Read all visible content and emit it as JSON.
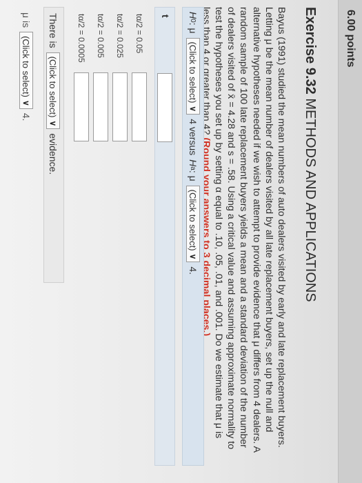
{
  "header": {
    "points": "6.00 points"
  },
  "exercise": {
    "number": "Exercise 9.32",
    "section": "METHODS AND APPLICATIONS"
  },
  "problem": {
    "text": "Bayus (1991) studied the mean numbers of auto dealers visited by early and late replacement buyers. Letting μ be the mean number of dealers visited by all late replacement buyers, set up the null and alternative hypotheses needed if we wish to attempt to provide evidence that μ differs from 4 dealers. A random sample of 100 late replacement buyers yields a mean and a standard deviation of the number of dealers visited of x̄ = 4.28 and s = .58. Using a critical value and assuming approximate normality to test the hypotheses you set up by setting α equal to .10, .05, .01, and .001. Do we estimate that μ is less than 4 or greater than 4?",
    "instruction": "(Round your answers to 3 decimal places.)"
  },
  "hypotheses": {
    "h0_symbol": "H",
    "h0_sub": "0",
    "h0_mu": " : μ",
    "h0_select": "(Click to select)",
    "h0_value": "4 versus",
    "ha_symbol": "H",
    "ha_sub": "a",
    "ha_mu": " : μ",
    "ha_select": "(Click to select)",
    "ha_value": "4."
  },
  "test_statistic": {
    "label": "t",
    "value": ""
  },
  "critical_values": [
    {
      "label": "tα/2 = 0.05",
      "value": ""
    },
    {
      "label": "tα/2 = 0.025",
      "value": ""
    },
    {
      "label": "tα/2 = 0.005",
      "value": ""
    },
    {
      "label": "tα/2 = 0.0005",
      "value": ""
    }
  ],
  "evidence": {
    "prefix": "There is",
    "select": "(Click to select)",
    "suffix": "evidence."
  },
  "conclusion": {
    "prefix": "μ is",
    "select": "(Click to select)",
    "suffix": "4."
  },
  "icons": {
    "caret": "chevron-down-icon"
  },
  "colors": {
    "instruction_red": "#d03124",
    "hypothesis_bar": "#d8e3ee"
  }
}
